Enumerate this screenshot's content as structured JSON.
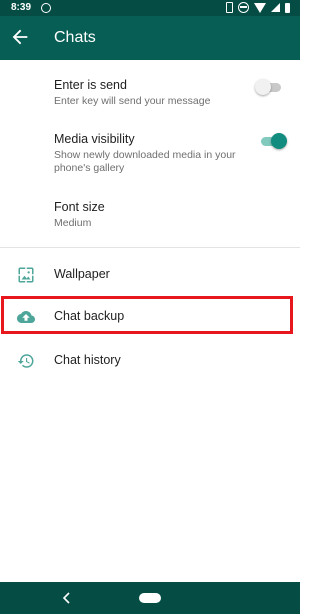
{
  "status_bar": {
    "time": "8:39",
    "icons": [
      "app-notification-icon",
      "vibrate-icon",
      "dnd-icon",
      "wifi-icon",
      "signal-icon",
      "battery-icon"
    ]
  },
  "toolbar": {
    "title": "Chats",
    "back_icon": "arrow-back-icon",
    "background": "#075e54"
  },
  "settings": [
    {
      "title": "Enter is send",
      "summary": "Enter key will send your message",
      "toggle": false
    },
    {
      "title": "Media visibility",
      "summary": "Show newly downloaded media in your phone's gallery",
      "toggle": true
    },
    {
      "title": "Font size",
      "summary": "Medium"
    }
  ],
  "options": [
    {
      "label": "Wallpaper",
      "icon": "wallpaper-icon"
    },
    {
      "label": "Chat backup",
      "icon": "cloud-upload-icon",
      "highlighted": true
    },
    {
      "label": "Chat history",
      "icon": "history-icon"
    }
  ],
  "colors": {
    "accent": "#128c7e",
    "icon": "#4ea59a",
    "highlight_border": "#e8161d",
    "status_bar": "#054d44"
  },
  "nav_bar": {
    "icons": [
      "nav-back-icon",
      "nav-home-pill"
    ]
  }
}
